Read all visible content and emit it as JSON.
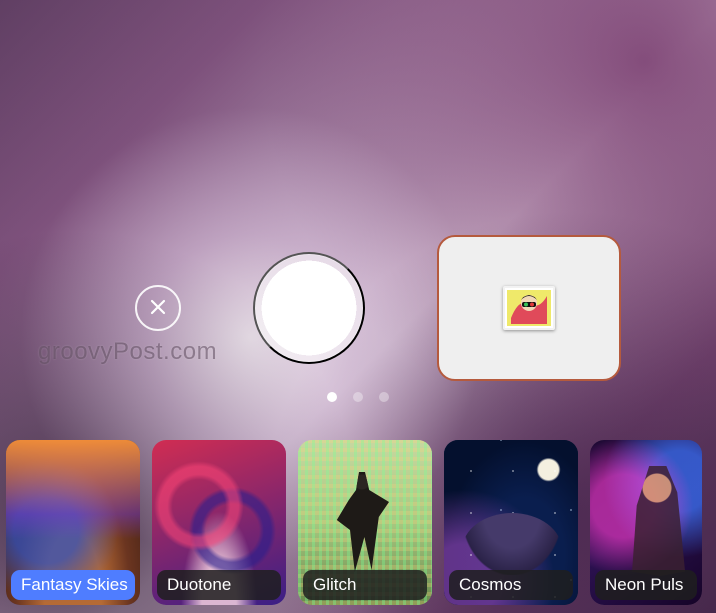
{
  "watermark": "groovyPost.com",
  "pagination": {
    "count": 3,
    "active_index": 0
  },
  "annotation": {
    "color": "#b55a3d"
  },
  "filters": [
    {
      "id": "fantasy-skies",
      "label": "Fantasy Skies",
      "selected": true
    },
    {
      "id": "duotone",
      "label": "Duotone",
      "selected": false
    },
    {
      "id": "glitch",
      "label": "Glitch",
      "selected": false
    },
    {
      "id": "cosmos",
      "label": "Cosmos",
      "selected": false
    },
    {
      "id": "neon-pulse",
      "label": "Neon Puls",
      "selected": false
    }
  ]
}
